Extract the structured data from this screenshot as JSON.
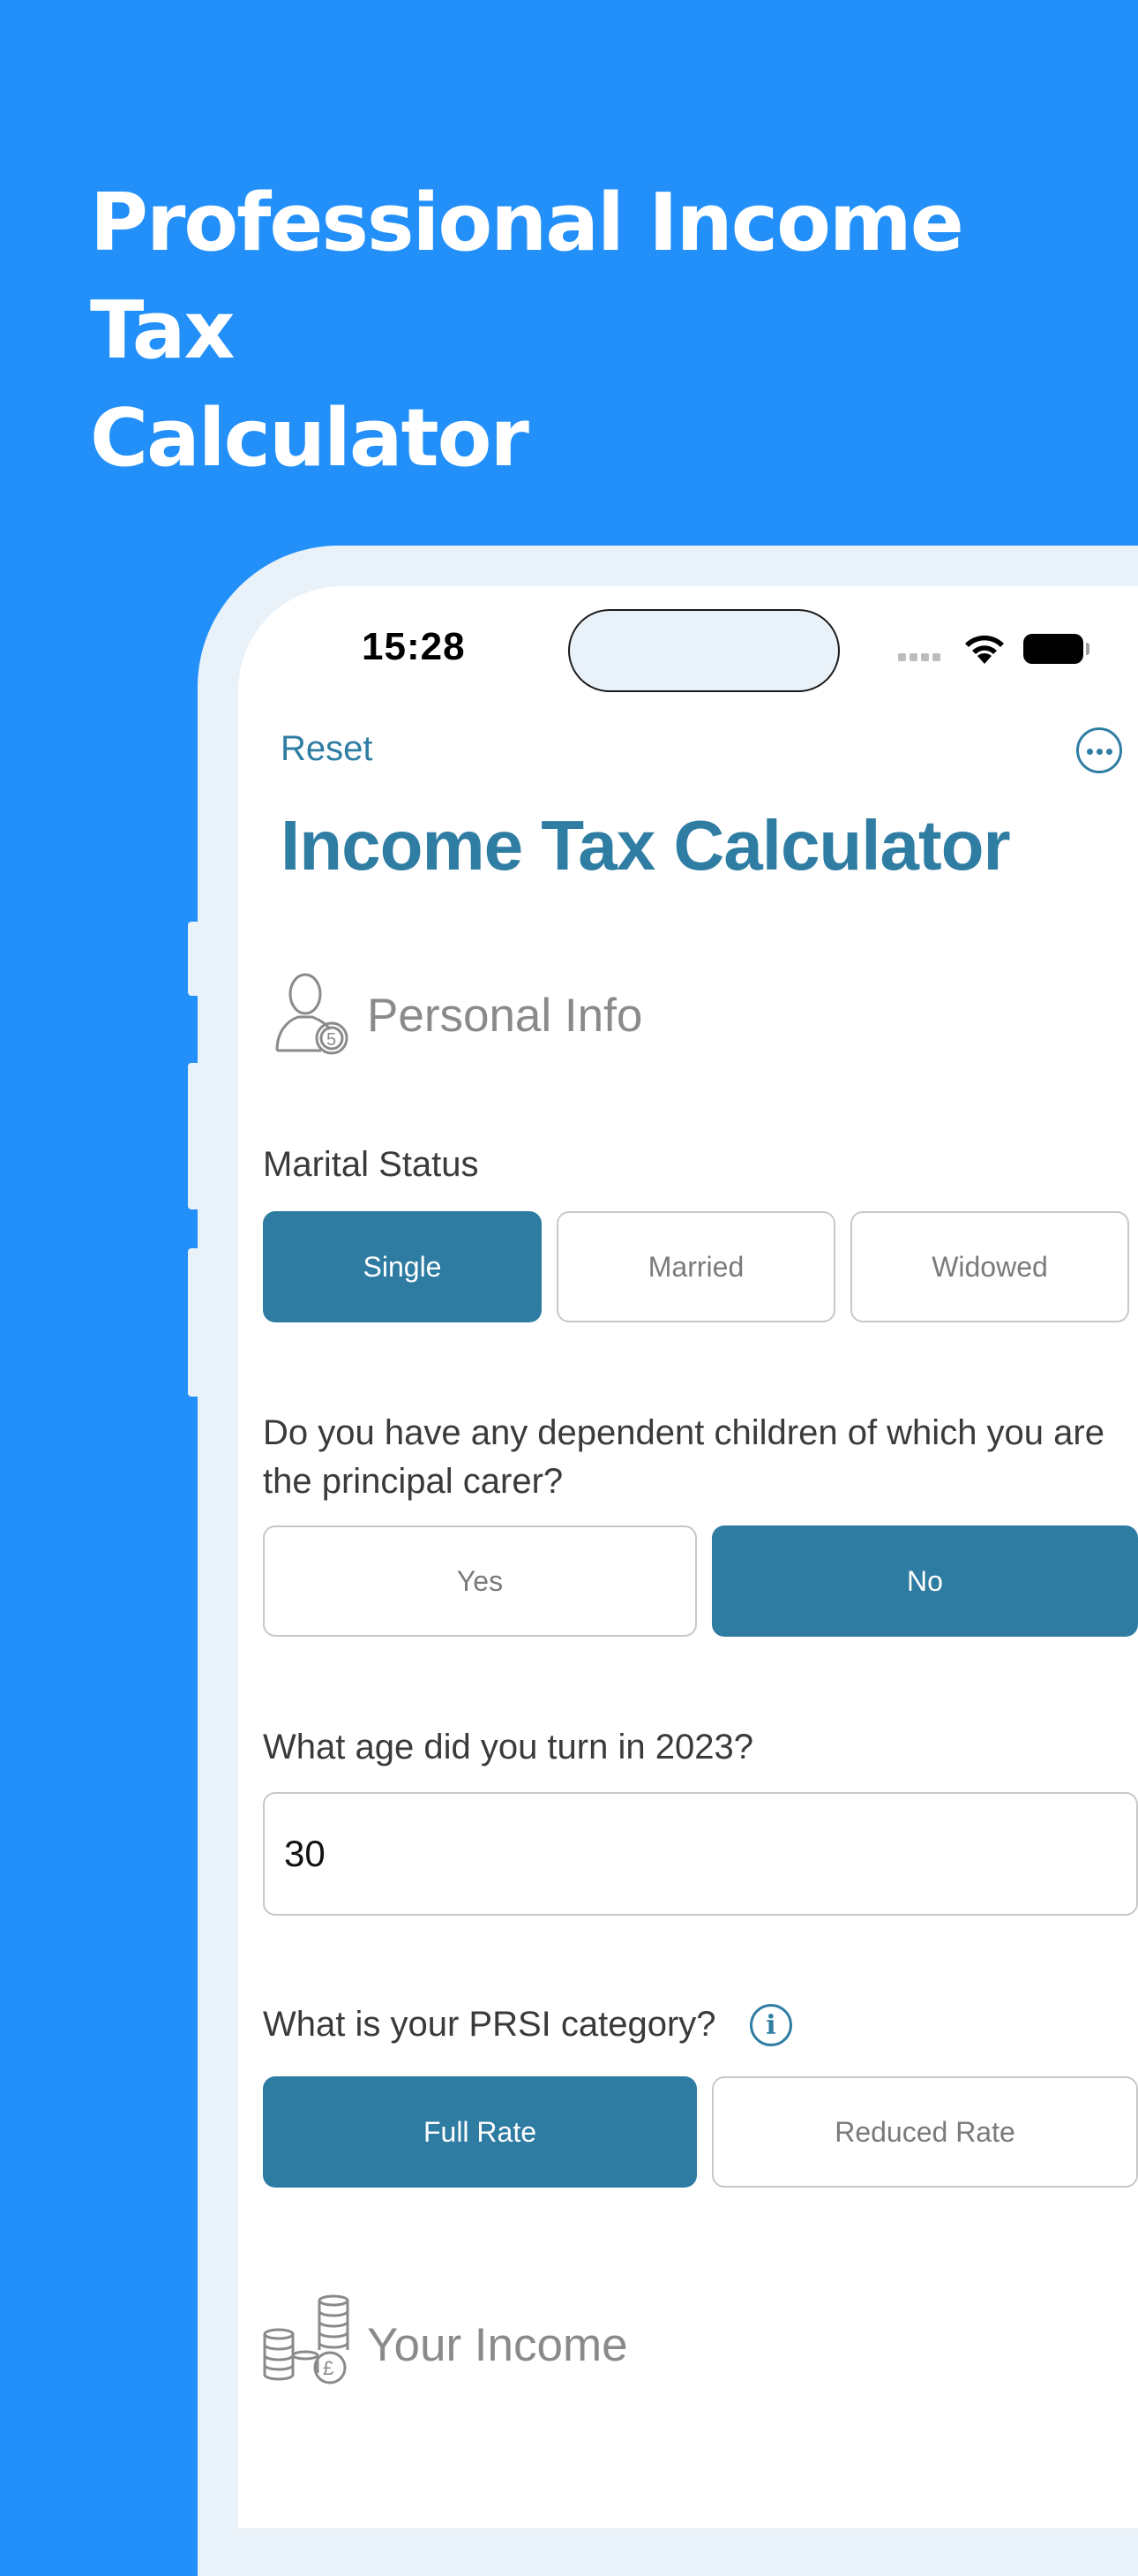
{
  "headline": {
    "line1": "Professional Income Tax",
    "line2": "Calculator"
  },
  "status_bar": {
    "time": "15:28"
  },
  "nav": {
    "reset_label": "Reset",
    "more_icon": "ellipsis-circle-icon"
  },
  "page_title": "Income Tax Calculator",
  "personal_info": {
    "section_title": "Personal Info",
    "icon": "person-badge-icon",
    "marital_status": {
      "label": "Marital Status",
      "options": [
        "Single",
        "Married",
        "Widowed"
      ],
      "selected": "Single"
    },
    "children": {
      "label": "Do you have any dependent children of which you are the principal carer?",
      "options": [
        "Yes",
        "No"
      ],
      "selected": "No"
    },
    "age": {
      "label": "What age did you turn in 2023?",
      "value": "30"
    },
    "prsi": {
      "label": "What is your PRSI category?",
      "info_icon": "info-circle-icon",
      "options": [
        "Full Rate",
        "Reduced Rate"
      ],
      "selected": "Full Rate"
    }
  },
  "income": {
    "section_title": "Your Income",
    "icon": "coins-pound-icon"
  },
  "colors": {
    "background": "#2390f9",
    "accent": "#2f7ca3",
    "phone_frame": "#e9f1f9"
  }
}
